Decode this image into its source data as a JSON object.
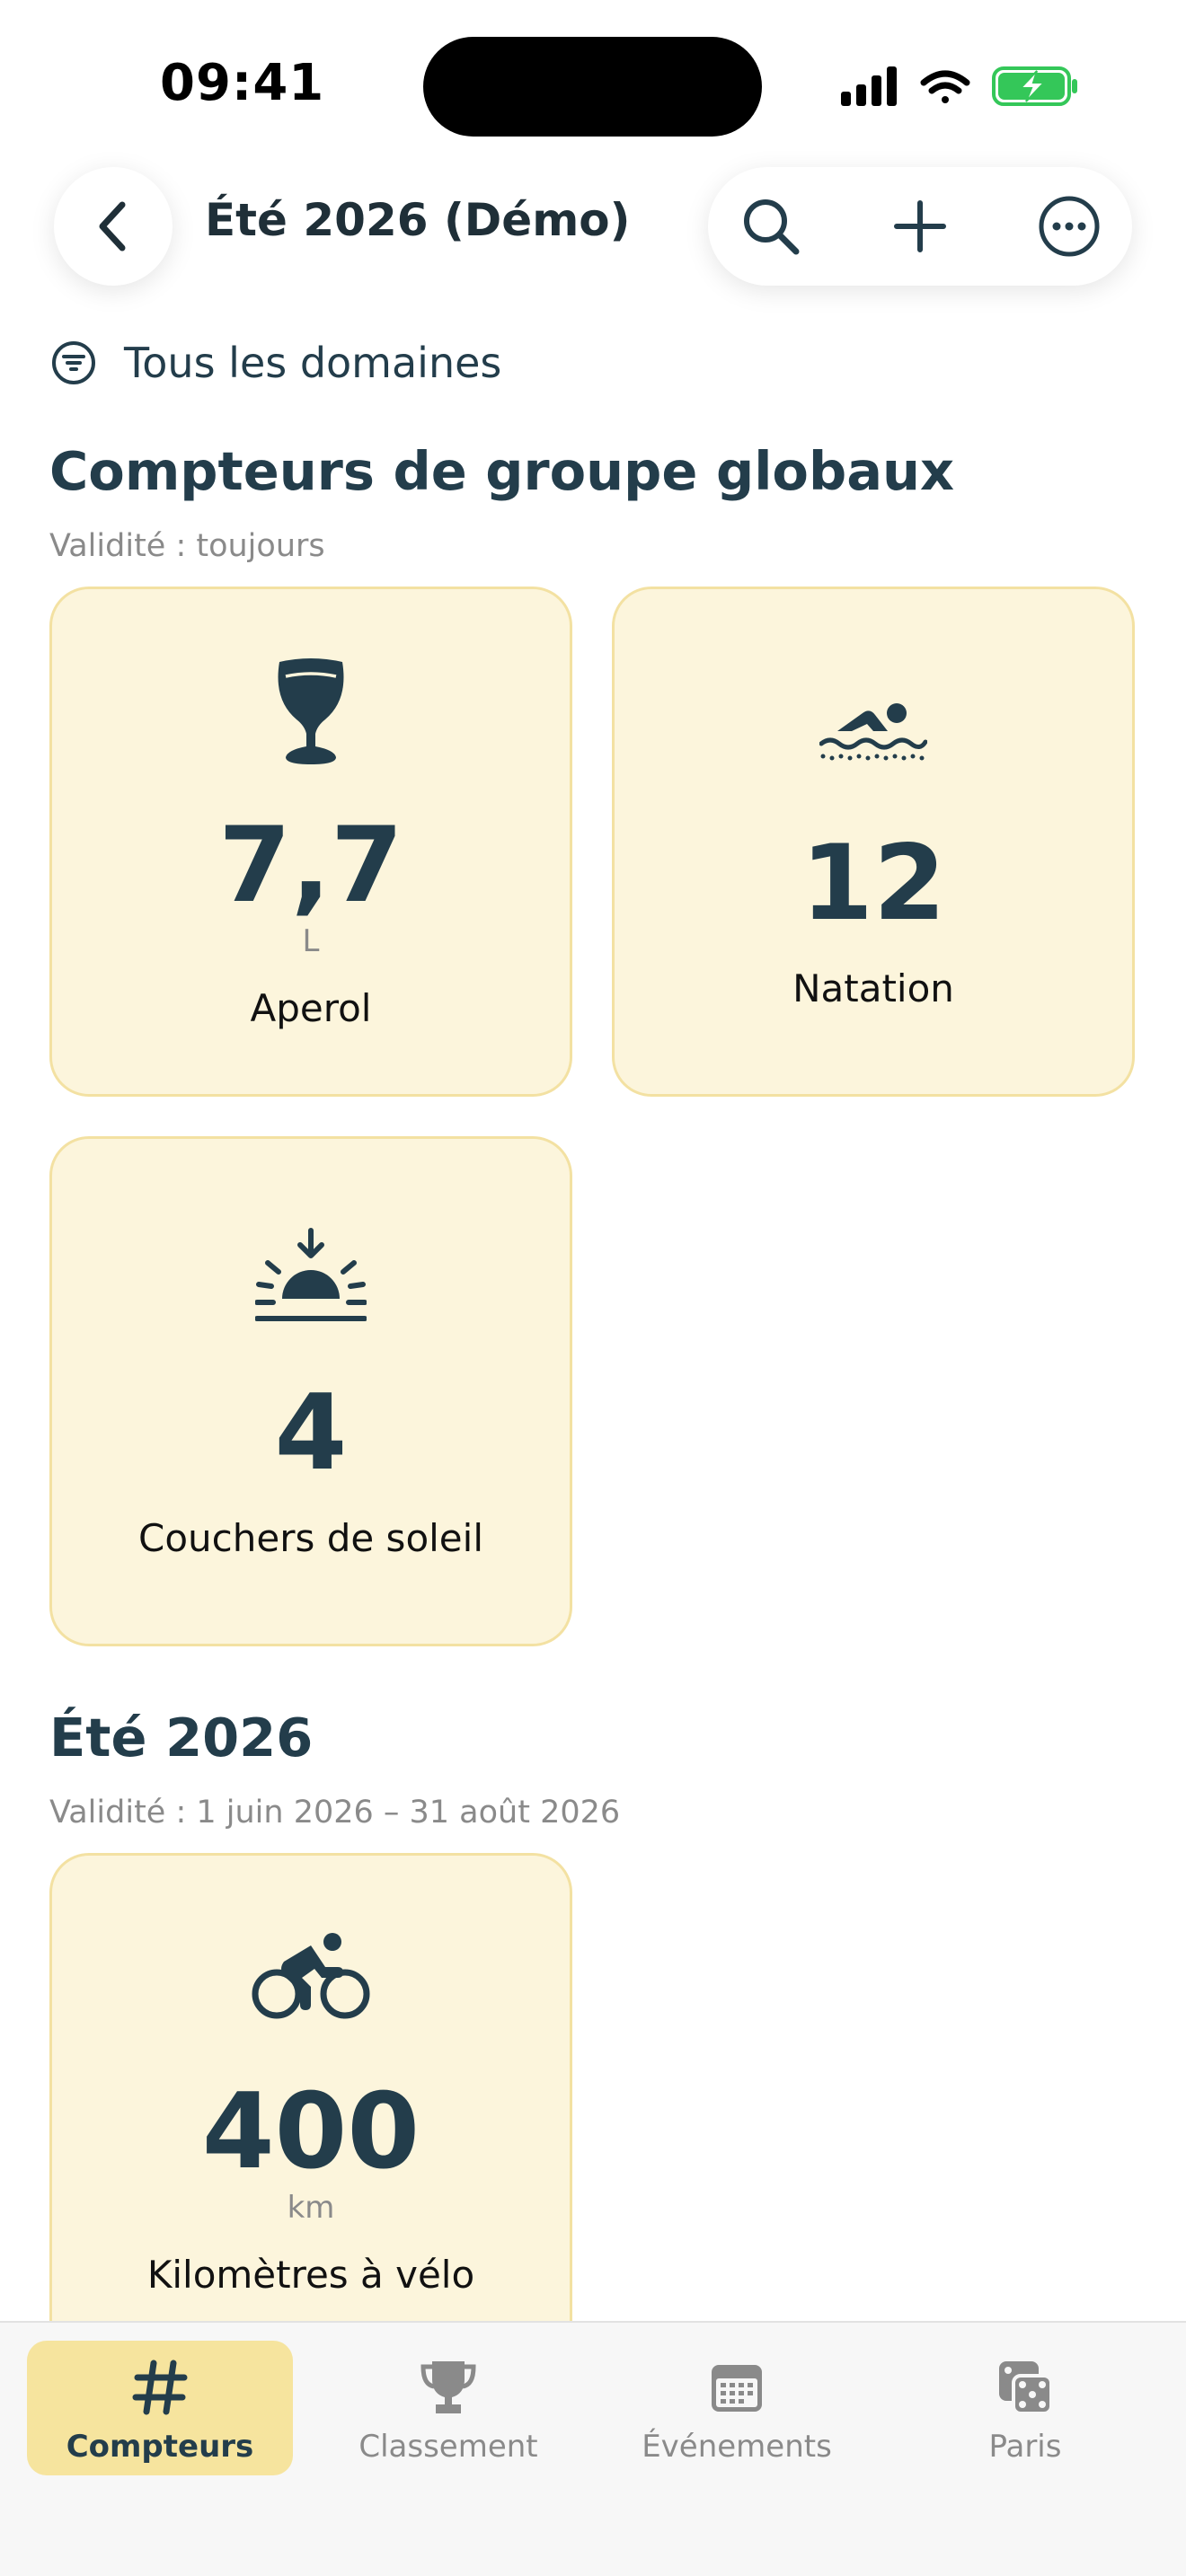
{
  "status_bar": {
    "time": "09:41"
  },
  "header": {
    "title": "Été 2026 (Démo)"
  },
  "filter": {
    "label": "Tous les domaines"
  },
  "sections": [
    {
      "title": "Compteurs de groupe globaux",
      "validity": "Validité : toujours",
      "cards": [
        {
          "icon": "wine-glass-icon",
          "value": "7,7",
          "unit": "L",
          "label": "Aperol"
        },
        {
          "icon": "swimmer-icon",
          "value": "12",
          "unit": "",
          "label": "Natation"
        },
        {
          "icon": "sunset-icon",
          "value": "4",
          "unit": "",
          "label": "Couchers de soleil"
        }
      ]
    },
    {
      "title": "Été 2026",
      "validity": "Validité : 1 juin 2026 – 31 août 2026",
      "cards": [
        {
          "icon": "cyclist-icon",
          "value": "400",
          "unit": "km",
          "label": "Kilomètres à vélo"
        }
      ]
    }
  ],
  "tabs": [
    {
      "label": "Compteurs",
      "icon": "hashtag-icon",
      "active": true
    },
    {
      "label": "Classement",
      "icon": "trophy-icon",
      "active": false
    },
    {
      "label": "Événements",
      "icon": "calendar-icon",
      "active": false
    },
    {
      "label": "Paris",
      "icon": "dice-icon",
      "active": false
    }
  ],
  "colors": {
    "accent": "#233d4b",
    "card_background": "#fcf5dc",
    "card_border": "#f3e1a2",
    "active_tab": "#f6e49e",
    "battery": "#34c759"
  }
}
